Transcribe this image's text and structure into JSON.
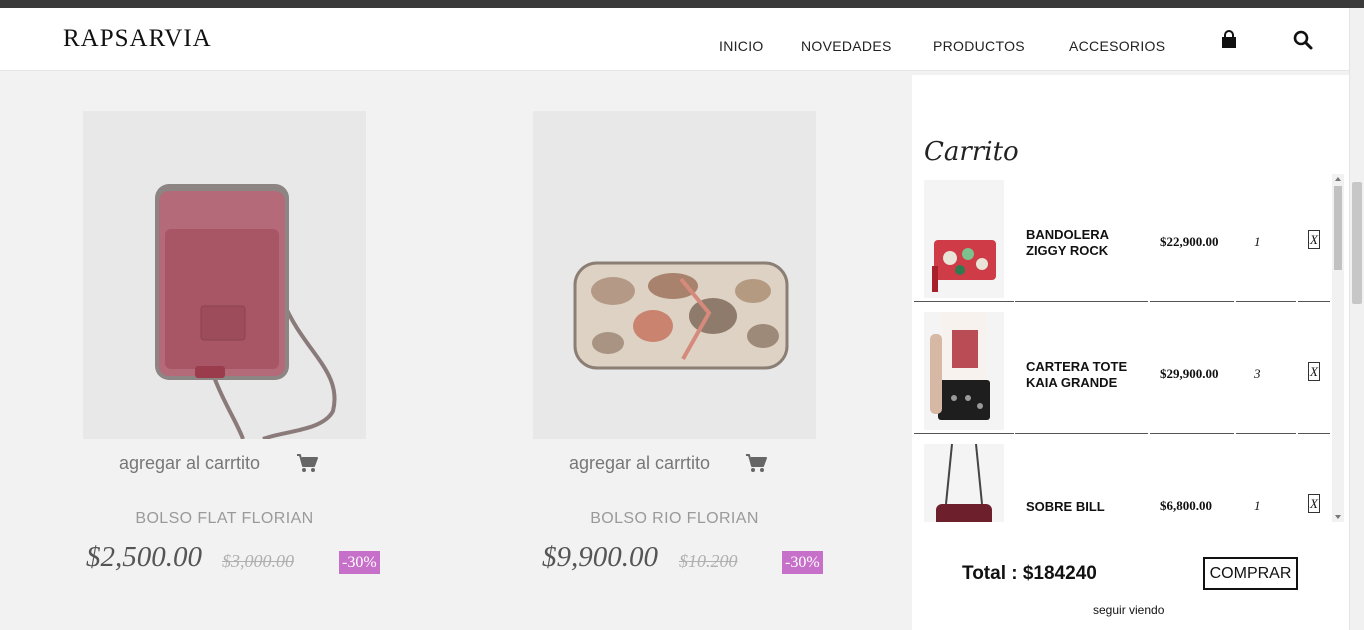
{
  "header": {
    "logo": "RAPSARVIA",
    "nav": [
      "INICIO",
      "NOVEDADES",
      "PRODUCTOS",
      "ACCESORIOS"
    ],
    "icons": [
      "shopping-bag-icon",
      "search-icon"
    ]
  },
  "products": [
    {
      "add_label": "agregar al carrtito",
      "name": "BOLSO FLAT FLORIAN",
      "price": "$2,500.00",
      "old_price": "$3,000.00",
      "discount": "-30%"
    },
    {
      "add_label": "agregar al carrtito",
      "name": "BOLSO RIO FLORIAN",
      "price": "$9,900.00",
      "old_price": "$10.200",
      "discount": "-30%"
    }
  ],
  "cart": {
    "title": "Carrito",
    "items": [
      {
        "name": "BANDOLERA ZIGGY ROCK",
        "price": "$22,900.00",
        "qty": "1",
        "remove": "X"
      },
      {
        "name": "CARTERA TOTE KAIA GRANDE",
        "price": "$29,900.00",
        "qty": "3",
        "remove": "X"
      },
      {
        "name": "SOBRE BILL",
        "price": "$6,800.00",
        "qty": "1",
        "remove": "X"
      }
    ],
    "total": "Total : $184240",
    "buy_label": "COMPRAR",
    "keep_label": "seguir viendo"
  },
  "colors": {
    "discount_badge": "#c770c9",
    "page_bg": "#f2f2f2",
    "panel_bg": "#ffffff"
  }
}
